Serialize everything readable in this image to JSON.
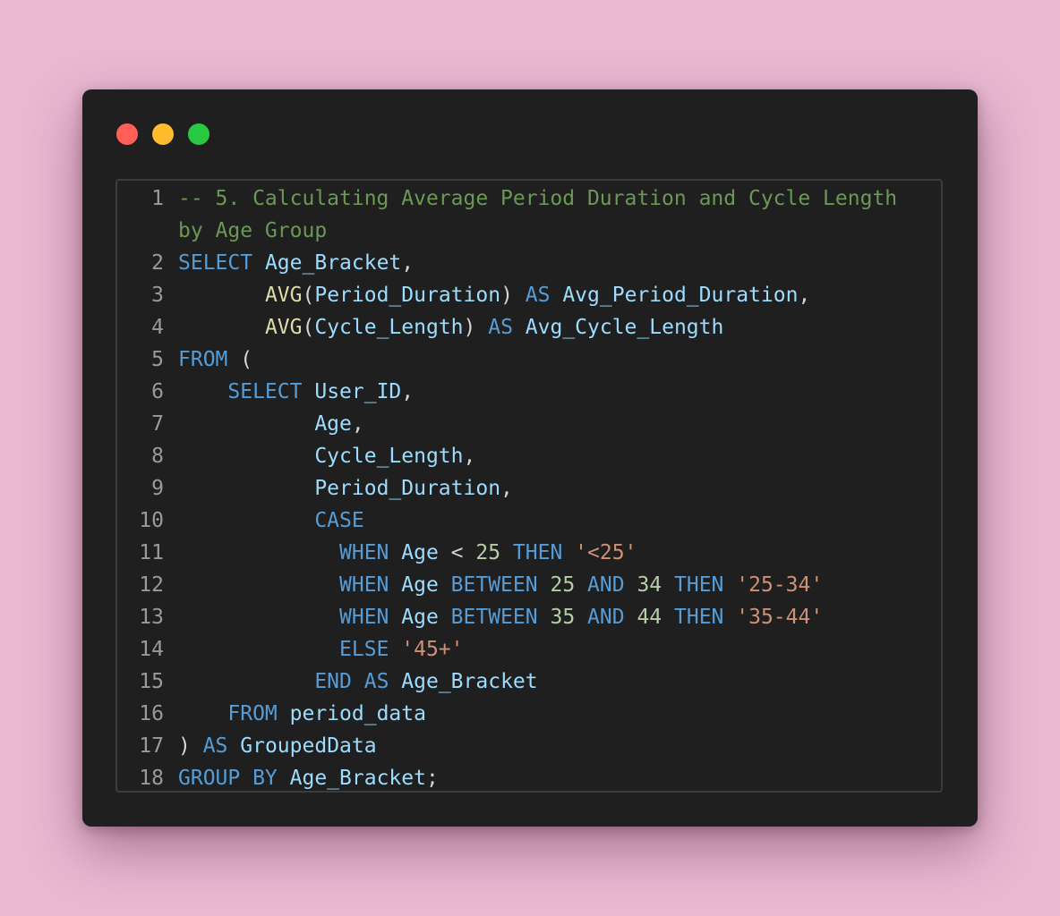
{
  "window": {
    "controls": [
      {
        "name": "close",
        "color": "#ff5f57"
      },
      {
        "name": "minimize",
        "color": "#febc2e"
      },
      {
        "name": "maximize",
        "color": "#28c840"
      }
    ]
  },
  "code": {
    "lines": [
      {
        "num": "1",
        "tokens": [
          {
            "t": "-- 5. Calculating Average Period Duration and Cycle Length",
            "k": "comment"
          }
        ]
      },
      {
        "num": "",
        "tokens": [
          {
            "t": "by Age Group",
            "k": "comment"
          }
        ]
      },
      {
        "num": "2",
        "tokens": [
          {
            "t": "SELECT",
            "k": "keyword"
          },
          {
            "t": " ",
            "k": "punct"
          },
          {
            "t": "Age_Bracket",
            "k": "ident"
          },
          {
            "t": ",",
            "k": "punct"
          }
        ]
      },
      {
        "num": "3",
        "tokens": [
          {
            "t": "       ",
            "k": "punct"
          },
          {
            "t": "AVG",
            "k": "func"
          },
          {
            "t": "(",
            "k": "punct"
          },
          {
            "t": "Period_Duration",
            "k": "ident"
          },
          {
            "t": ") ",
            "k": "punct"
          },
          {
            "t": "AS",
            "k": "keyword"
          },
          {
            "t": " ",
            "k": "punct"
          },
          {
            "t": "Avg_Period_Duration",
            "k": "ident"
          },
          {
            "t": ",",
            "k": "punct"
          }
        ]
      },
      {
        "num": "4",
        "tokens": [
          {
            "t": "       ",
            "k": "punct"
          },
          {
            "t": "AVG",
            "k": "func"
          },
          {
            "t": "(",
            "k": "punct"
          },
          {
            "t": "Cycle_Length",
            "k": "ident"
          },
          {
            "t": ") ",
            "k": "punct"
          },
          {
            "t": "AS",
            "k": "keyword"
          },
          {
            "t": " ",
            "k": "punct"
          },
          {
            "t": "Avg_Cycle_Length",
            "k": "ident"
          }
        ]
      },
      {
        "num": "5",
        "tokens": [
          {
            "t": "FROM",
            "k": "keyword"
          },
          {
            "t": " (",
            "k": "punct"
          }
        ]
      },
      {
        "num": "6",
        "tokens": [
          {
            "t": "    ",
            "k": "punct"
          },
          {
            "t": "SELECT",
            "k": "keyword"
          },
          {
            "t": " ",
            "k": "punct"
          },
          {
            "t": "User_ID",
            "k": "ident"
          },
          {
            "t": ",",
            "k": "punct"
          }
        ]
      },
      {
        "num": "7",
        "tokens": [
          {
            "t": "           ",
            "k": "punct"
          },
          {
            "t": "Age",
            "k": "ident"
          },
          {
            "t": ",",
            "k": "punct"
          }
        ]
      },
      {
        "num": "8",
        "tokens": [
          {
            "t": "           ",
            "k": "punct"
          },
          {
            "t": "Cycle_Length",
            "k": "ident"
          },
          {
            "t": ",",
            "k": "punct"
          }
        ]
      },
      {
        "num": "9",
        "tokens": [
          {
            "t": "           ",
            "k": "punct"
          },
          {
            "t": "Period_Duration",
            "k": "ident"
          },
          {
            "t": ",",
            "k": "punct"
          }
        ]
      },
      {
        "num": "10",
        "tokens": [
          {
            "t": "           ",
            "k": "punct"
          },
          {
            "t": "CASE",
            "k": "keyword"
          }
        ]
      },
      {
        "num": "11",
        "tokens": [
          {
            "t": "             ",
            "k": "punct"
          },
          {
            "t": "WHEN",
            "k": "keyword"
          },
          {
            "t": " ",
            "k": "punct"
          },
          {
            "t": "Age",
            "k": "ident"
          },
          {
            "t": " < ",
            "k": "punct"
          },
          {
            "t": "25",
            "k": "number"
          },
          {
            "t": " ",
            "k": "punct"
          },
          {
            "t": "THEN",
            "k": "keyword"
          },
          {
            "t": " ",
            "k": "punct"
          },
          {
            "t": "'<25'",
            "k": "string"
          }
        ]
      },
      {
        "num": "12",
        "tokens": [
          {
            "t": "             ",
            "k": "punct"
          },
          {
            "t": "WHEN",
            "k": "keyword"
          },
          {
            "t": " ",
            "k": "punct"
          },
          {
            "t": "Age",
            "k": "ident"
          },
          {
            "t": " ",
            "k": "punct"
          },
          {
            "t": "BETWEEN",
            "k": "keyword"
          },
          {
            "t": " ",
            "k": "punct"
          },
          {
            "t": "25",
            "k": "number"
          },
          {
            "t": " ",
            "k": "punct"
          },
          {
            "t": "AND",
            "k": "keyword"
          },
          {
            "t": " ",
            "k": "punct"
          },
          {
            "t": "34",
            "k": "number"
          },
          {
            "t": " ",
            "k": "punct"
          },
          {
            "t": "THEN",
            "k": "keyword"
          },
          {
            "t": " ",
            "k": "punct"
          },
          {
            "t": "'25-34'",
            "k": "string"
          }
        ]
      },
      {
        "num": "13",
        "tokens": [
          {
            "t": "             ",
            "k": "punct"
          },
          {
            "t": "WHEN",
            "k": "keyword"
          },
          {
            "t": " ",
            "k": "punct"
          },
          {
            "t": "Age",
            "k": "ident"
          },
          {
            "t": " ",
            "k": "punct"
          },
          {
            "t": "BETWEEN",
            "k": "keyword"
          },
          {
            "t": " ",
            "k": "punct"
          },
          {
            "t": "35",
            "k": "number"
          },
          {
            "t": " ",
            "k": "punct"
          },
          {
            "t": "AND",
            "k": "keyword"
          },
          {
            "t": " ",
            "k": "punct"
          },
          {
            "t": "44",
            "k": "number"
          },
          {
            "t": " ",
            "k": "punct"
          },
          {
            "t": "THEN",
            "k": "keyword"
          },
          {
            "t": " ",
            "k": "punct"
          },
          {
            "t": "'35-44'",
            "k": "string"
          }
        ]
      },
      {
        "num": "14",
        "tokens": [
          {
            "t": "             ",
            "k": "punct"
          },
          {
            "t": "ELSE",
            "k": "keyword"
          },
          {
            "t": " ",
            "k": "punct"
          },
          {
            "t": "'45+'",
            "k": "string"
          }
        ]
      },
      {
        "num": "15",
        "tokens": [
          {
            "t": "           ",
            "k": "punct"
          },
          {
            "t": "END",
            "k": "keyword"
          },
          {
            "t": " ",
            "k": "punct"
          },
          {
            "t": "AS",
            "k": "keyword"
          },
          {
            "t": " ",
            "k": "punct"
          },
          {
            "t": "Age_Bracket",
            "k": "ident"
          }
        ]
      },
      {
        "num": "16",
        "tokens": [
          {
            "t": "    ",
            "k": "punct"
          },
          {
            "t": "FROM",
            "k": "keyword"
          },
          {
            "t": " ",
            "k": "punct"
          },
          {
            "t": "period_data",
            "k": "ident"
          }
        ]
      },
      {
        "num": "17",
        "tokens": [
          {
            "t": ") ",
            "k": "punct"
          },
          {
            "t": "AS",
            "k": "keyword"
          },
          {
            "t": " ",
            "k": "punct"
          },
          {
            "t": "GroupedData",
            "k": "ident"
          }
        ]
      },
      {
        "num": "18",
        "tokens": [
          {
            "t": "GROUP BY",
            "k": "keyword"
          },
          {
            "t": " ",
            "k": "punct"
          },
          {
            "t": "Age_Bracket",
            "k": "ident"
          },
          {
            "t": ";",
            "k": "punct"
          }
        ]
      }
    ]
  }
}
